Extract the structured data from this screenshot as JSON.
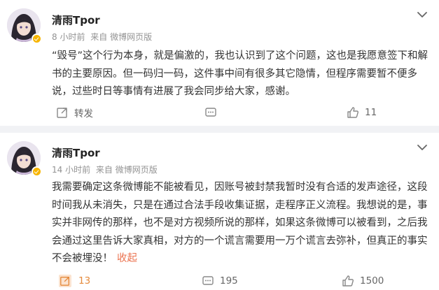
{
  "posts": [
    {
      "username": "清雨Tpor",
      "time": "8 小时前",
      "source": "来自 微博网页版",
      "content": "“毁号”这个行为本身，就是偏激的，我也认识到了这个问题，这也是我愿意签下和解书的主要原因。但一码归一码，这件事中间有很多其它隐情，但程序需要暂不便多说，过些时日等事情有进展了我会同步给大家，感谢。",
      "repost_label": "转发",
      "comment_count": "",
      "like_count": "11",
      "collapse_label": ""
    },
    {
      "username": "清雨Tpor",
      "time": "14 小时前",
      "source": "来自 微博网页版",
      "content": "我需要确定这条微博能不能被看见，因账号被封禁我暂时没有合适的发声途径，这段时间我从未消失，只是在通过合法手段收集证据，走程序正义流程。我想说的是，事实并非网传的那样，也不是对方视频所说的那样，如果这条微博可以被看到，之后我会通过这里告诉大家真相，对方的一个谎言需要用一万个谎言去弥补，但真正的事实不会被埋没！",
      "repost_label": "13",
      "comment_count": "195",
      "like_count": "1500",
      "collapse_label": "收起"
    }
  ],
  "colors": {
    "accent": "#eb7350",
    "meta_gray": "#939393",
    "badge": "#f7b500"
  },
  "icons": [
    "avatar",
    "verified-badge-icon",
    "chevron-down-icon",
    "repost-icon",
    "comment-icon",
    "like-icon"
  ]
}
